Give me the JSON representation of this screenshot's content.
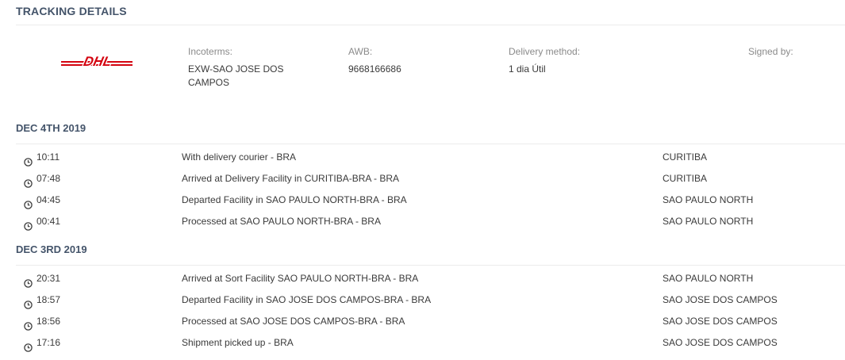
{
  "header": {
    "title": "TRACKING DETAILS"
  },
  "carrier": {
    "logo_text": "DHL",
    "logo_color": "#d40511",
    "logo_icon": "dhl-logo"
  },
  "summary": {
    "incoterms": {
      "label": "Incoterms:",
      "value": "EXW-SAO JOSE DOS CAMPOS"
    },
    "awb": {
      "label": "AWB:",
      "value": "9668166686"
    },
    "delivery_method": {
      "label": "Delivery method:",
      "value": "1 dia Útil"
    },
    "signed_by": {
      "label": "Signed by:",
      "value": ""
    }
  },
  "groups": [
    {
      "date": "DEC 4TH 2019",
      "events": [
        {
          "time": "10:11",
          "description": "With delivery courier - BRA",
          "location": "CURITIBA"
        },
        {
          "time": "07:48",
          "description": "Arrived at Delivery Facility in CURITIBA-BRA - BRA",
          "location": "CURITIBA"
        },
        {
          "time": "04:45",
          "description": "Departed Facility in SAO PAULO NORTH-BRA - BRA",
          "location": "SAO PAULO NORTH"
        },
        {
          "time": "00:41",
          "description": "Processed at SAO PAULO NORTH-BRA - BRA",
          "location": "SAO PAULO NORTH"
        }
      ]
    },
    {
      "date": "DEC 3RD 2019",
      "events": [
        {
          "time": "20:31",
          "description": "Arrived at Sort Facility SAO PAULO NORTH-BRA - BRA",
          "location": "SAO PAULO NORTH"
        },
        {
          "time": "18:57",
          "description": "Departed Facility in SAO JOSE DOS CAMPOS-BRA - BRA",
          "location": "SAO JOSE DOS CAMPOS"
        },
        {
          "time": "18:56",
          "description": "Processed at SAO JOSE DOS CAMPOS-BRA - BRA",
          "location": "SAO JOSE DOS CAMPOS"
        },
        {
          "time": "17:16",
          "description": "Shipment picked up - BRA",
          "location": "SAO JOSE DOS CAMPOS"
        }
      ]
    }
  ],
  "icons": {
    "event_time": "clock-icon"
  },
  "colors": {
    "heading": "#44546a",
    "label": "#8a8a8a",
    "text": "#3a3a3a",
    "divider": "#ececec"
  }
}
